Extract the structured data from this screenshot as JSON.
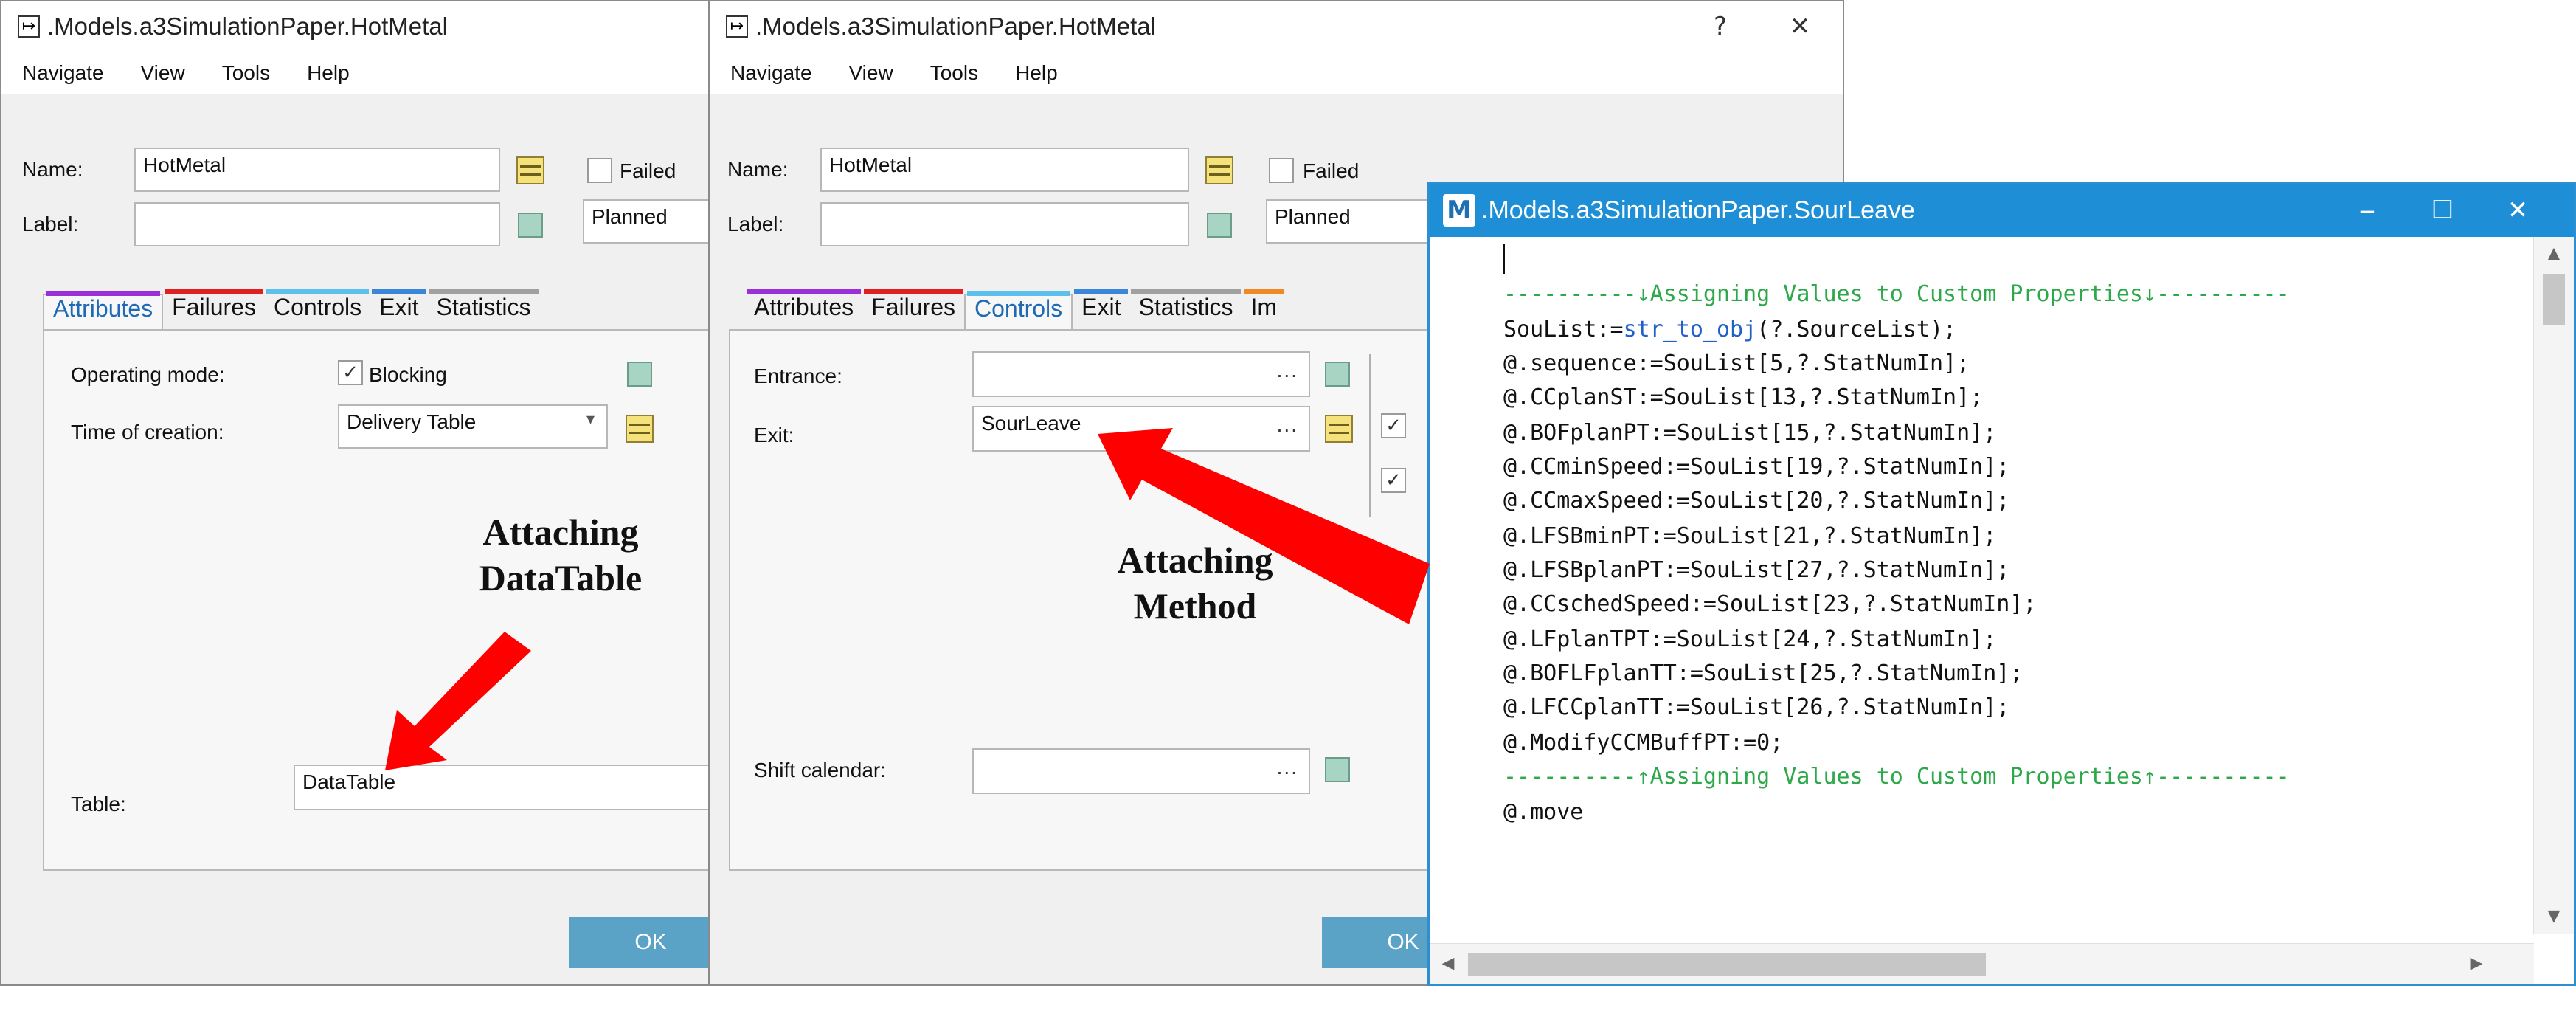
{
  "dialog1": {
    "title": ".Models.a3SimulationPaper.HotMetal",
    "menu": [
      "Navigate",
      "View",
      "Tools",
      "Help"
    ],
    "name_label": "Name:",
    "name_value": "HotMetal",
    "label_label": "Label:",
    "label_value": "",
    "failed_label": "Failed",
    "planned_value": "Planned",
    "tabs": [
      "Attributes",
      "Failures",
      "Controls",
      "Exit",
      "Statistics"
    ],
    "active_tab": "Attributes",
    "operating_mode_label": "Operating mode:",
    "blocking_label": "Blocking",
    "time_of_creation_label": "Time of creation:",
    "time_of_creation_value": "Delivery Table",
    "table_label": "Table:",
    "table_value": "DataTable",
    "ok_label": "OK"
  },
  "dialog2": {
    "title": ".Models.a3SimulationPaper.HotMetal",
    "help_button": "?",
    "close_button": "✕",
    "menu": [
      "Navigate",
      "View",
      "Tools",
      "Help"
    ],
    "name_label": "Name:",
    "name_value": "HotMetal",
    "label_label": "Label:",
    "label_value": "",
    "failed_label": "Failed",
    "planned_value": "Planned",
    "tabs": [
      "Attributes",
      "Failures",
      "Controls",
      "Exit",
      "Statistics",
      "Im"
    ],
    "active_tab": "Controls",
    "entrance_label": "Entrance:",
    "entrance_value": "",
    "exit_label": "Exit:",
    "exit_value": "SourLeave",
    "shift_calendar_label": "Shift calendar:",
    "shift_calendar_value": "",
    "dots": "...",
    "ok_label": "OK"
  },
  "method": {
    "title": ".Models.a3SimulationPaper.SourLeave",
    "icon_letter": "M",
    "minimize": "‒",
    "maximize": "☐",
    "close": "✕",
    "code_lines": [
      {
        "text": "",
        "kind": "plain"
      },
      {
        "text": "----------↓Assigning Values to Custom Properties↓----------",
        "kind": "comment"
      },
      {
        "text_a": "SouList:=",
        "text_fn": "str_to_obj",
        "text_b": "(?.SourceList);",
        "kind": "call"
      },
      {
        "text": "@.sequence:=SouList[5,?.StatNumIn];",
        "kind": "plain"
      },
      {
        "text": "@.CCplanST:=SouList[13,?.StatNumIn];",
        "kind": "plain"
      },
      {
        "text": "@.BOFplanPT:=SouList[15,?.StatNumIn];",
        "kind": "plain"
      },
      {
        "text": "@.CCminSpeed:=SouList[19,?.StatNumIn];",
        "kind": "plain"
      },
      {
        "text": "@.CCmaxSpeed:=SouList[20,?.StatNumIn];",
        "kind": "plain"
      },
      {
        "text": "@.LFSBminPT:=SouList[21,?.StatNumIn];",
        "kind": "plain"
      },
      {
        "text": "@.LFSBplanPT:=SouList[27,?.StatNumIn];",
        "kind": "plain"
      },
      {
        "text": "@.CCschedSpeed:=SouList[23,?.StatNumIn];",
        "kind": "plain"
      },
      {
        "text": "@.LFplanTPT:=SouList[24,?.StatNumIn];",
        "kind": "plain"
      },
      {
        "text": "@.BOFLFplanTT:=SouList[25,?.StatNumIn];",
        "kind": "plain"
      },
      {
        "text": "@.LFCCplanTT:=SouList[26,?.StatNumIn];",
        "kind": "plain"
      },
      {
        "text": "@.ModifyCCMBuffPT:=0;",
        "kind": "plain"
      },
      {
        "text": "----------↑Assigning Values to Custom Properties↑----------",
        "kind": "comment"
      },
      {
        "text": "@.move",
        "kind": "plain"
      }
    ]
  },
  "annotations": {
    "datatable_line1": "Attaching",
    "datatable_line2": "DataTable",
    "method_line1": "Attaching",
    "method_line2": "Method"
  },
  "colors": {
    "tab_attributes": "#9b30d9",
    "tab_failures": "#e02020",
    "tab_controls": "#5bc0eb",
    "tab_exit": "#3a86d8",
    "tab_statistics": "#a0a0a0",
    "tab_im": "#f08a24",
    "method_titlebar": "#1e8fd6",
    "arrow": "#ff0000"
  }
}
